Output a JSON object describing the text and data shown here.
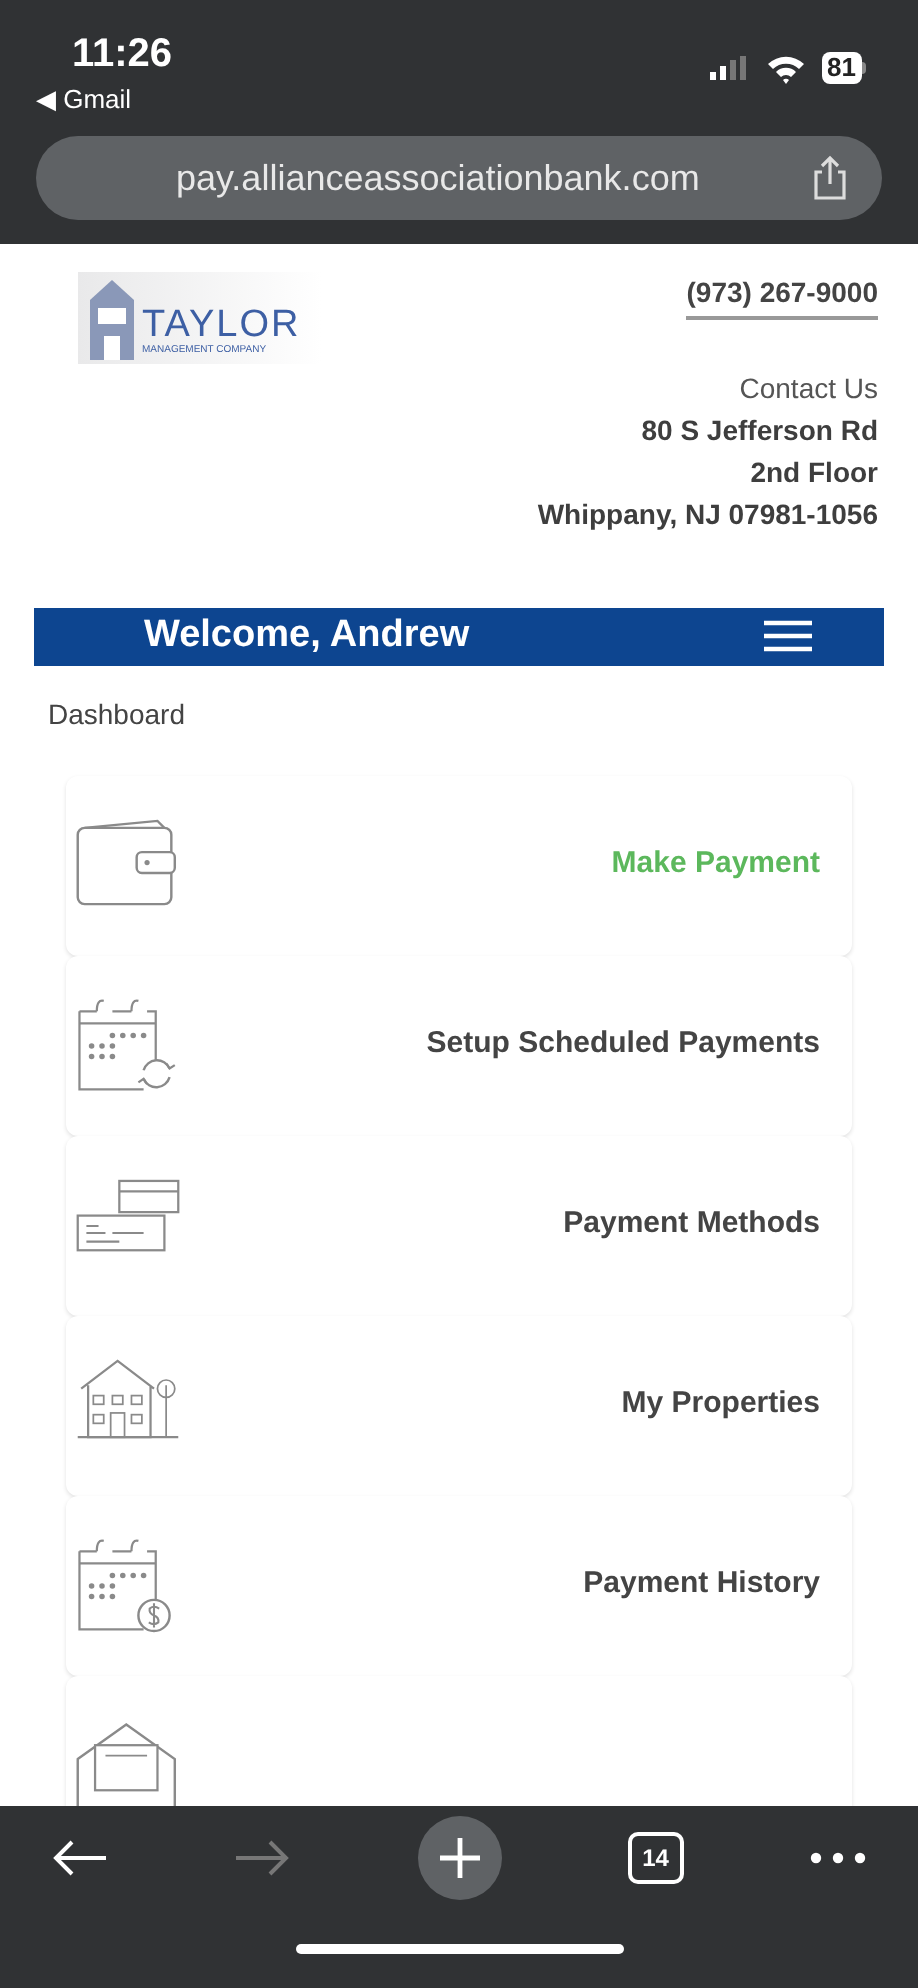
{
  "status_bar": {
    "time": "11:26",
    "back_app": "◀ Gmail",
    "battery": "81"
  },
  "address_bar": {
    "url": "pay.allianceassociationbank.com"
  },
  "header": {
    "logo": {
      "name": "TAYLOR",
      "subtitle": "MANAGEMENT COMPANY"
    },
    "phone": "(973) 267-9000",
    "contact_label": "Contact Us",
    "address": [
      "80 S Jefferson Rd",
      "2nd Floor",
      "Whippany, NJ 07981-1056"
    ]
  },
  "nav": {
    "title": "Welcome, Andrew"
  },
  "breadcrumb": "Dashboard",
  "menu_items": [
    {
      "kind": "wallet",
      "label": "Make Payment",
      "selected": true
    },
    {
      "kind": "calendar-sync",
      "label": "Setup Scheduled Payments",
      "selected": false
    },
    {
      "kind": "cards",
      "label": "Payment Methods",
      "selected": false
    },
    {
      "kind": "house",
      "label": "My Properties",
      "selected": false
    },
    {
      "kind": "calendar-dollar",
      "label": "Payment History",
      "selected": false
    },
    {
      "kind": "envelope"
    }
  ],
  "toolbar": {
    "tab_count": "14"
  }
}
